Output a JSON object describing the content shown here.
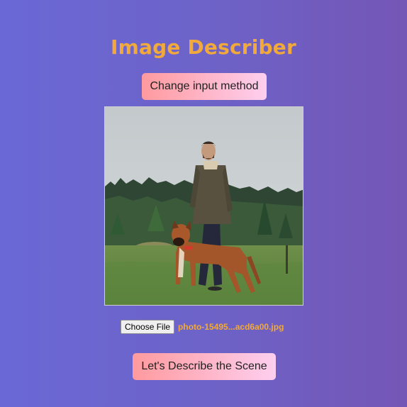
{
  "header": {
    "title": "Image Describer"
  },
  "controls": {
    "change_input_label": "Change input method",
    "choose_file_label": "Choose File",
    "file_name": "photo-15495...acd6a00.jpg",
    "describe_label": "Let's Describe the Scene"
  },
  "colors": {
    "title": "#f0a93a",
    "button_gradient_start": "#ff9a9e",
    "button_gradient_end": "#fecfef",
    "background_start": "#6a68d6",
    "background_end": "#7456b6"
  }
}
